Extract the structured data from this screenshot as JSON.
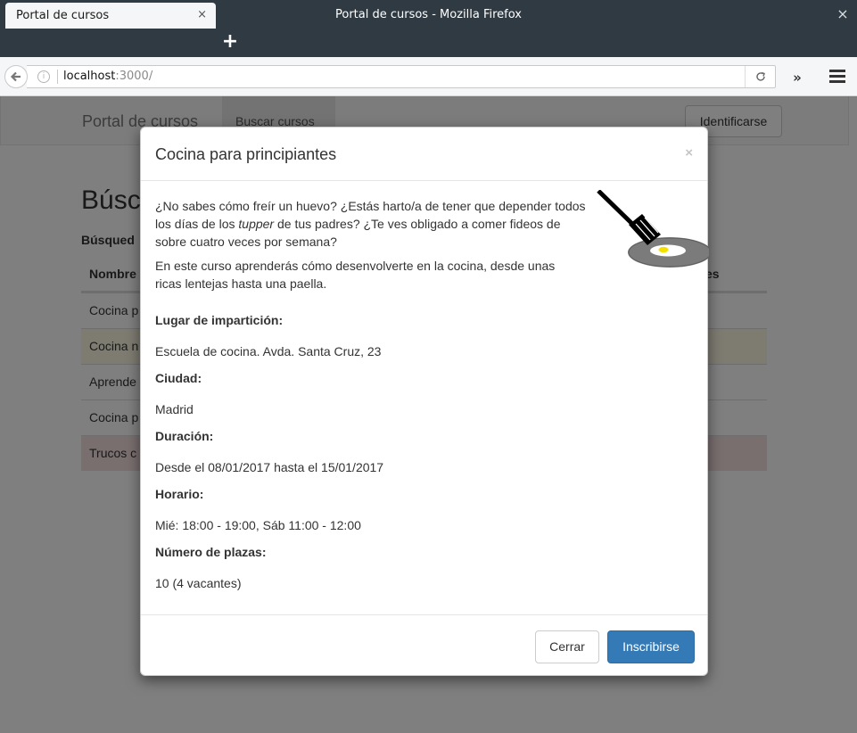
{
  "window": {
    "title": "Portal de cursos - Mozilla Firefox",
    "close_glyph": "×"
  },
  "tab": {
    "label": "Portal de cursos",
    "close_glyph": "×",
    "new_tab_glyph": "+"
  },
  "navbar": {
    "url_host": "localhost",
    "url_rest": ":3000/",
    "reload_glyph": "C",
    "overflow_glyph": "»"
  },
  "app": {
    "brand": "Portal de cursos",
    "nav_active": "Buscar cursos",
    "login_label": "Identificarse",
    "page_title": "Búsc",
    "page_subtitle": "Búsqued",
    "table": {
      "head_left": "Nombre",
      "head_right": "es",
      "rows": [
        "Cocina p",
        "Cocina n",
        "Aprende",
        "Cocina p",
        "Trucos c"
      ]
    }
  },
  "modal": {
    "title": "Cocina para principiantes",
    "close_glyph": "×",
    "intro_part1": "¿No sabes cómo freír un huevo? ¿Estás harto/a de tener que depender todos los días de los ",
    "intro_em": "tupper",
    "intro_part2": " de tus padres? ¿Te ves obligado a comer fideos de sobre cuatro veces por semana?",
    "intro_2": "En este curso aprenderás cómo desenvolverte en la cocina, desde unas ricas lentejas hasta una paella.",
    "fields": [
      {
        "label": "Lugar de impartición:",
        "value": "Escuela de cocina. Avda. Santa Cruz, 23"
      },
      {
        "label": "Ciudad:",
        "value": "Madrid"
      },
      {
        "label": "Duración:",
        "value": "Desde el 08/01/2017 hasta el 15/01/2017"
      },
      {
        "label": "Horario:",
        "value": "Mié: 18:00 - 19:00, Sáb 11:00 - 12:00"
      },
      {
        "label": "Número de plazas:",
        "value": "10 (4 vacantes)"
      }
    ],
    "cerrar_label": "Cerrar",
    "inscribir_label": "Inscribirse",
    "colors": {
      "primary": "#337ab7",
      "egg_yolk": "#f4e100",
      "plate": "#777777"
    }
  }
}
